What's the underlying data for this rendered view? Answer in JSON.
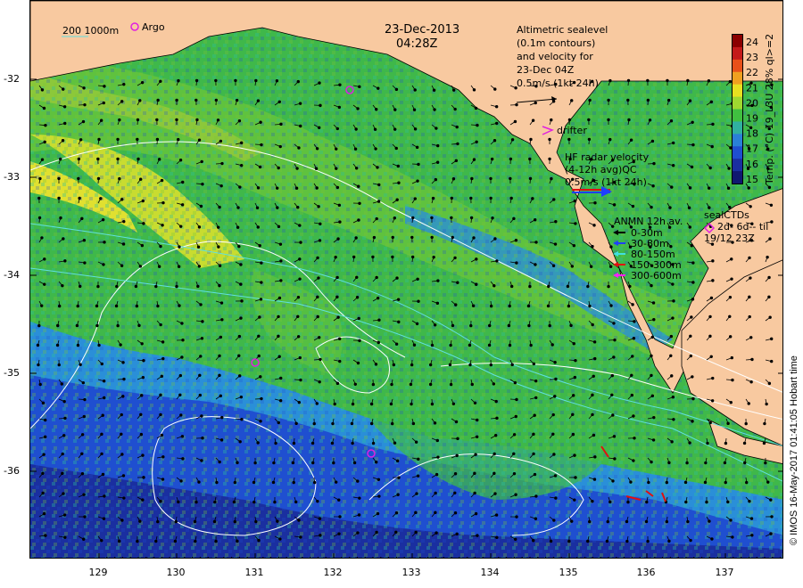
{
  "map": {
    "date": "23-Dec-2013",
    "time": "04:28Z",
    "longitude_ticks": [
      "129",
      "130",
      "131",
      "132",
      "133",
      "134",
      "135",
      "136",
      "137"
    ],
    "latitude_ticks": [
      "-32",
      "-33",
      "-34",
      "-35",
      "-36"
    ],
    "land_color": "#f8c9a0",
    "water_colors": [
      "#1a2fa0",
      "#1f4fd0",
      "#2a8fd8",
      "#2fbf9a",
      "#3fb84a",
      "#7cc63a",
      "#e0e030",
      "#f0b020"
    ]
  },
  "legend": {
    "bathy_label": "200  1000m",
    "argo_label": "Argo",
    "altimetry_lines": [
      "Altimetric sealevel",
      "(0.1m contours)",
      "and velocity for",
      "23-Dec 04Z",
      "0.5m/s (1kt 24h)"
    ],
    "drifter_label": "drifter",
    "hf_radar_lines": [
      "HF radar velocity",
      "(4-12h avg)QC",
      "0.5m/s (1kt 24h)"
    ],
    "anmn_title": "ANMN 12h av.",
    "anmn_items": [
      {
        "label": "0-30m",
        "color": "#000000"
      },
      {
        "label": "30-80m",
        "color": "#1f3fff"
      },
      {
        "label": "80-150m",
        "color": "#40e0e0"
      },
      {
        "label": "150-300m",
        "color": "#e01010"
      },
      {
        "label": "300-600m",
        "color": "#ff20ff"
      }
    ],
    "sealctd_lines": [
      "sealCTDs",
      "2d- 6d-- til",
      "19/12 23Z"
    ]
  },
  "colorbar": {
    "ticks": [
      "24",
      "23",
      "22",
      "21",
      "20",
      "19",
      "18",
      "17",
      "16",
      "15"
    ],
    "label": "Temp. (°C) 19_L3U 28% ql>=2",
    "colors": [
      "#8b0000",
      "#c41a1a",
      "#e8501a",
      "#f0a020",
      "#e8e020",
      "#a0d830",
      "#40c040",
      "#30b0a0",
      "#2a80d8",
      "#1f4fd0",
      "#1a2fa0",
      "#101870"
    ]
  },
  "credit": "© IMOS 16-May-2017 01:41:05 Hobart time"
}
